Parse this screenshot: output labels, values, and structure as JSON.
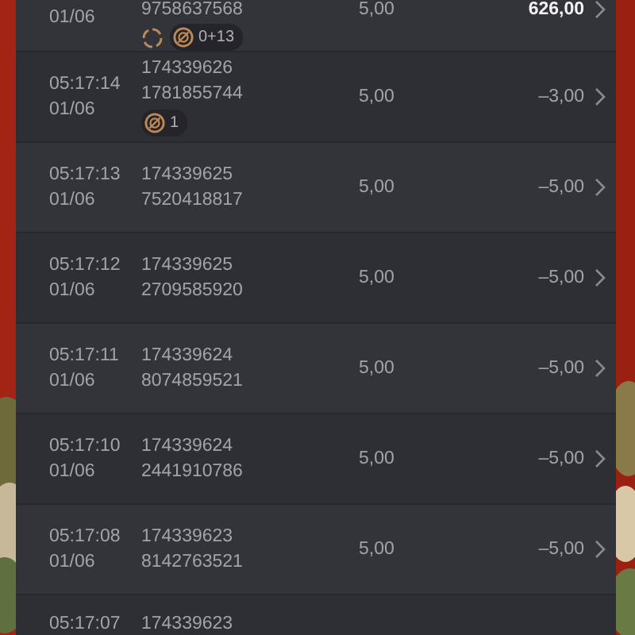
{
  "rows": [
    {
      "date": "01/06",
      "ids": [
        "9758637568"
      ],
      "badges": [
        {
          "kind": "spinner"
        },
        {
          "kind": "count",
          "text": "0+13"
        }
      ],
      "bet": "5,00",
      "win": "626,00",
      "highlight": true
    },
    {
      "time": "05:17:14",
      "date": "01/06",
      "ids": [
        "174339626",
        "1781855744"
      ],
      "badges": [
        {
          "kind": "count",
          "text": "1"
        }
      ],
      "bet": "5,00",
      "win": "–3,00",
      "highlight": false
    },
    {
      "time": "05:17:13",
      "date": "01/06",
      "ids": [
        "174339625",
        "7520418817"
      ],
      "bet": "5,00",
      "win": "–5,00",
      "highlight": false
    },
    {
      "time": "05:17:12",
      "date": "01/06",
      "ids": [
        "174339625",
        "2709585920"
      ],
      "bet": "5,00",
      "win": "–5,00",
      "highlight": false
    },
    {
      "time": "05:17:11",
      "date": "01/06",
      "ids": [
        "174339624",
        "8074859521"
      ],
      "bet": "5,00",
      "win": "–5,00",
      "highlight": false
    },
    {
      "time": "05:17:10",
      "date": "01/06",
      "ids": [
        "174339624",
        "2441910786"
      ],
      "bet": "5,00",
      "win": "–5,00",
      "highlight": false
    },
    {
      "time": "05:17:08",
      "date": "01/06",
      "ids": [
        "174339623",
        "8142763521"
      ],
      "bet": "5,00",
      "win": "–5,00",
      "highlight": false
    },
    {
      "time": "05:17:07",
      "ids": [
        "174339623"
      ]
    }
  ]
}
